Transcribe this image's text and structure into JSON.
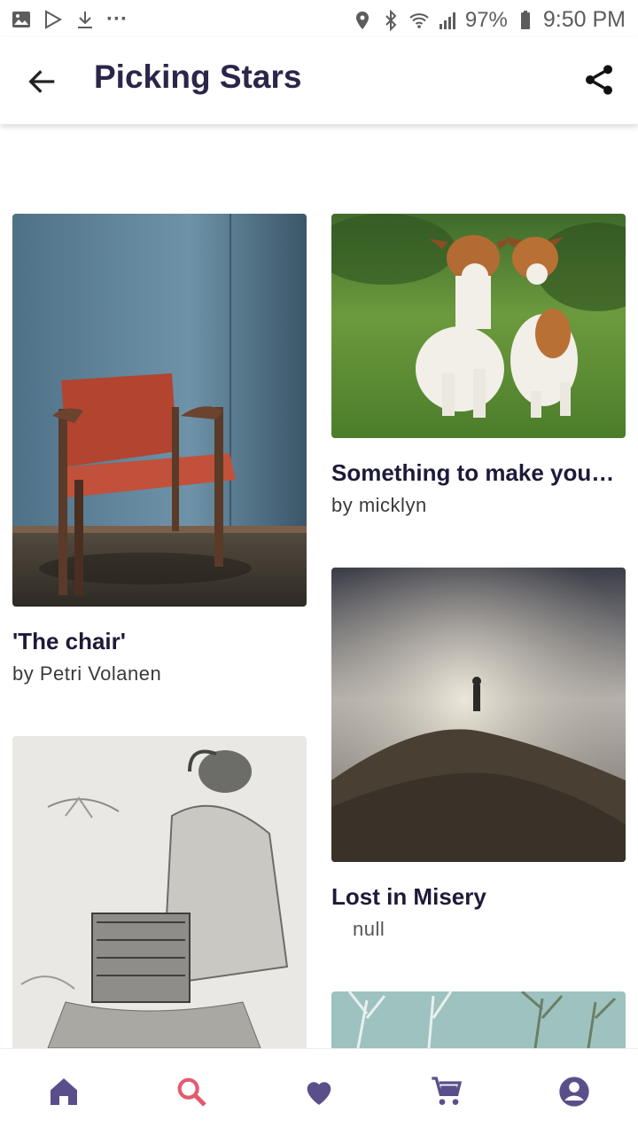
{
  "status_bar": {
    "battery": "97%",
    "time": "9:50 PM",
    "more": "···"
  },
  "appbar": {
    "title": "Picking Stars"
  },
  "cards": [
    {
      "title": "'The chair'",
      "author": "by Petri Volanen"
    },
    {
      "title": "Something to make you…",
      "author": "by micklyn"
    },
    {
      "title": "Lost in Misery",
      "author": "null"
    }
  ],
  "bottom_nav": {
    "items": [
      "home-icon",
      "search-icon",
      "favorite-icon",
      "cart-icon",
      "account-icon"
    ],
    "active": "search-icon"
  },
  "colors": {
    "primary": "#5a4f8a",
    "active": "#e35b6e",
    "title": "#2b2649"
  }
}
